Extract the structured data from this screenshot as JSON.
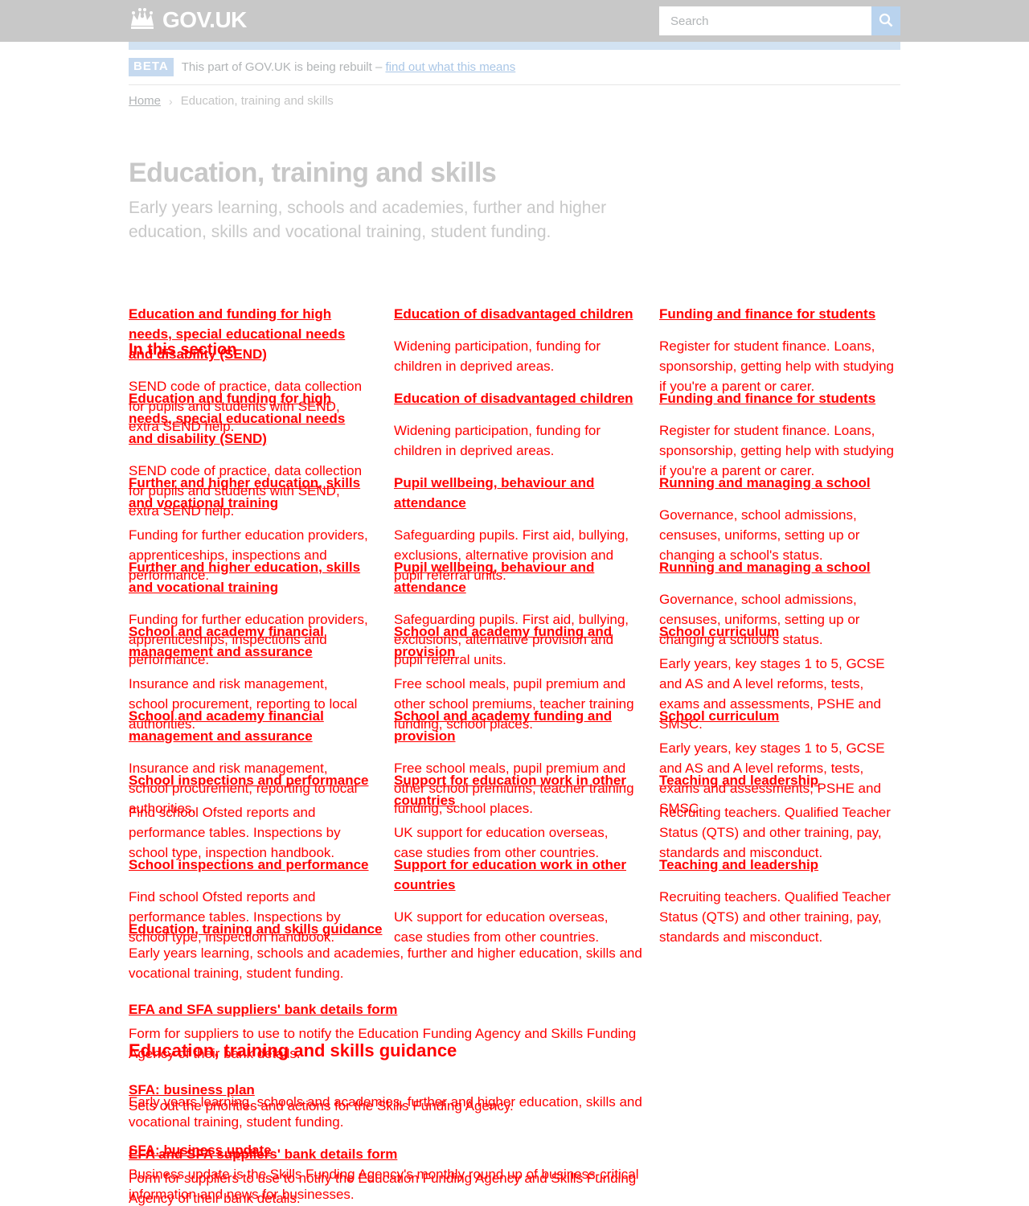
{
  "header": {
    "logo_text": "GOV.UK",
    "search_placeholder": "Search"
  },
  "beta": {
    "tag": "BETA",
    "text": "This part of GOV.UK is being rebuilt –",
    "link": "find out what this means"
  },
  "breadcrumb": {
    "home": "Home",
    "current": "Education, training and skills"
  },
  "page": {
    "title": "Education, training and skills",
    "subtitle": "Early years learning, schools and academies, further and higher education, skills and vocational training, student funding."
  },
  "in_this_section": "In this section",
  "topics": [
    {
      "title": "Education and funding for high needs, special educational needs and disability (SEND)",
      "description": "SEND code of practice, data collection for pupils and students with SEND, extra SEND help."
    },
    {
      "title": "Education of disadvantaged children",
      "description": "Widening participation, funding for children in deprived areas."
    },
    {
      "title": "Funding and finance for students",
      "description": "Register for student finance. Loans, sponsorship, getting help with studying if you're a parent or carer."
    },
    {
      "title": "Further and higher education, skills and vocational training",
      "description": "Funding for further education providers, apprenticeships, inspections and performance."
    },
    {
      "title": "Pupil wellbeing, behaviour and attendance",
      "description": "Safeguarding pupils. First aid, bullying, exclusions, alternative provision and pupil referral units."
    },
    {
      "title": "Running and managing a school",
      "description": "Governance, school admissions, censuses, uniforms, setting up or changing a school's status."
    },
    {
      "title": "School and academy financial management and assurance",
      "description": "Insurance and risk management, school procurement, reporting to local authorities."
    },
    {
      "title": "School and academy funding and provision",
      "description": "Free school meals, pupil premium and other school premiums, teacher training funding, school places."
    },
    {
      "title": "School curriculum",
      "description": "Early years, key stages 1 to 5, GCSE and AS and A level reforms, tests, exams and assessments, PSHE and SMSC."
    },
    {
      "title": "School inspections and performance",
      "description": "Find school Ofsted reports and performance tables. Inspections by school type, inspection handbook."
    },
    {
      "title": "Support for education work in other countries",
      "description": "UK support for education overseas, case studies from other countries."
    },
    {
      "title": "Teaching and leadership",
      "description": "Recruiting teachers. Qualified Teacher Status (QTS) and other training, pay, standards and misconduct."
    }
  ],
  "guidance_heading": "Education, training and skills guidance",
  "guidance": [
    {
      "title": "Education, training and skills guidance",
      "description": "Early years learning, schools and academies, further and higher education, skills and vocational training, student funding."
    },
    {
      "title": "EFA and SFA suppliers' bank details form",
      "description": "Form for suppliers to use to notify the Education Funding Agency and Skills Funding Agency of their bank details."
    },
    {
      "title": "SFA: business plan",
      "description": "Sets out the priorities and actions for the Skills Funding Agency."
    },
    {
      "title": "SFA: business update",
      "description": "Business update is the Skills Funding Agency's monthly round up of business-critical information and news for businesses."
    }
  ],
  "colors": {
    "header_bg": "#c8c8c8",
    "accent_bar": "#d2e2f2",
    "overlay_text": "#ff0000",
    "faded_text": "#c8c8c8"
  }
}
